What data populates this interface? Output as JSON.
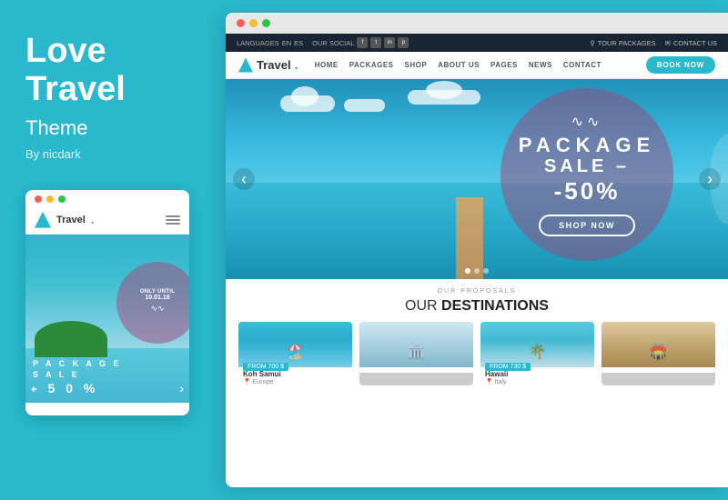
{
  "left": {
    "title_line1": "Love",
    "title_line2": "Travel",
    "subtitle": "Theme",
    "author": "By nicdark",
    "mobile": {
      "logo_text": "Travel",
      "logo_period": ".",
      "only_until": "ONLY UNTIL",
      "date": "10.01.18",
      "package_label": "P A C K A G E",
      "sale_label": "S A L E",
      "fifty_label": "- 5 0 %"
    }
  },
  "browser": {
    "dots": [
      "red",
      "yellow",
      "green"
    ]
  },
  "topbar": {
    "languages": "LANGUAGES",
    "lang_en": "EN",
    "lang_es": "ES",
    "social_label": "OUR SOCIAL",
    "tour_packages": "TOUR PACKAGES",
    "contact_us": "CONTACT US"
  },
  "nav": {
    "logo_text": "Travel",
    "logo_period": ".",
    "links": [
      "HOME",
      "PACKAGES",
      "SHOP",
      "ABOUT US",
      "PAGES",
      "NEWS",
      "CONTACT"
    ],
    "book_now": "BOOK NOW"
  },
  "hero": {
    "tilde": "∿∿",
    "package_label": "PACKAGE",
    "sale_label": "SALE –",
    "percent_label": "-50%",
    "shop_now": "SHOP NOW",
    "dots": [
      true,
      false,
      false
    ]
  },
  "destinations": {
    "label": "OUR PROPOSALS",
    "title_plain": "OUR ",
    "title_bold": "DESTINATIONS",
    "cards": [
      {
        "name": "Koh Samui",
        "location": "Europe",
        "price": "FROM 700 $",
        "color": "koh"
      },
      {
        "name": "",
        "location": "",
        "price": "",
        "color": "europe"
      },
      {
        "name": "Hawaii",
        "location": "Italy",
        "price": "FROM 730 $",
        "color": "hawaii"
      },
      {
        "name": "",
        "location": "",
        "price": "",
        "color": "italy"
      }
    ]
  }
}
